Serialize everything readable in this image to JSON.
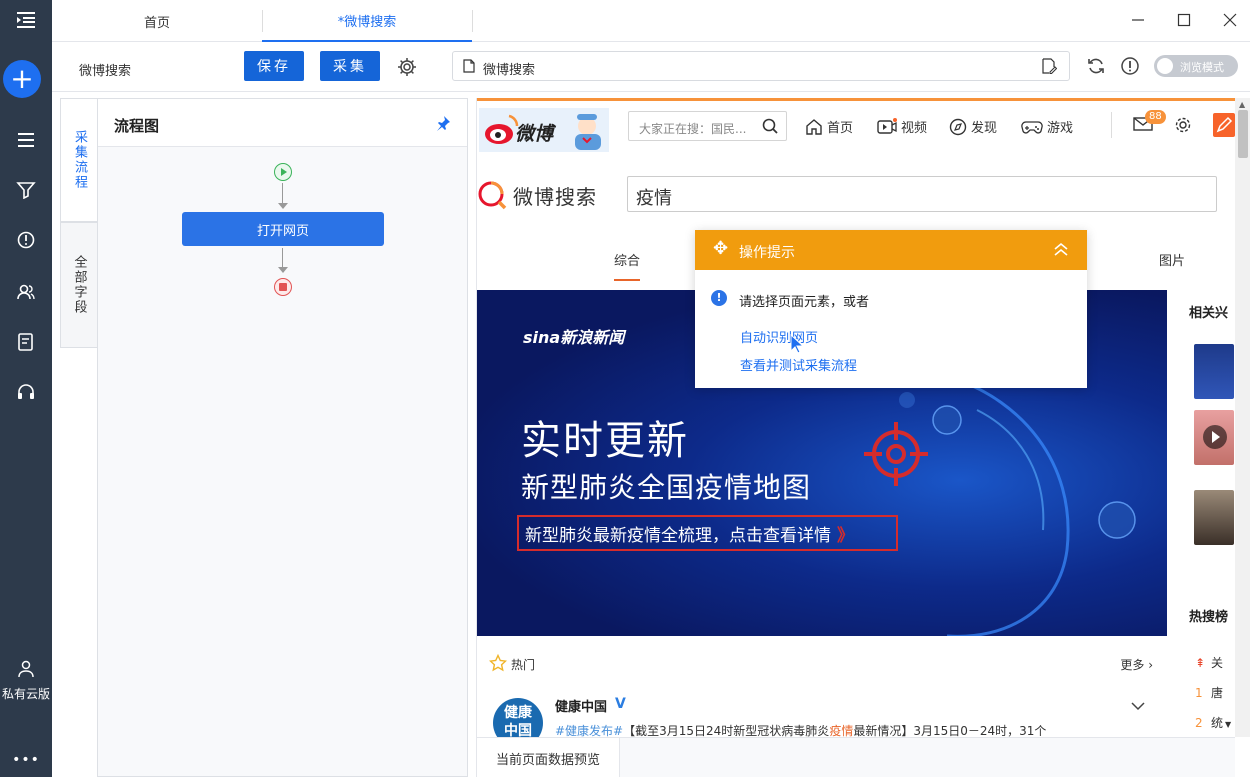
{
  "rail": {
    "icons": [
      "menu-collapse-icon",
      "plus-icon",
      "list-icon",
      "funnel-icon",
      "clock-alert-icon",
      "users-icon",
      "report-icon",
      "headset-icon",
      "user-icon"
    ],
    "account_label": "私有云版",
    "more_label": "•••",
    "accent": "#1e6ff0"
  },
  "tabs": [
    {
      "label": "首页"
    },
    {
      "label": "*微博搜索"
    }
  ],
  "toolbar": {
    "task_name": "微博搜索",
    "save_label": "保存",
    "collect_label": "采集",
    "url_text": "微博搜索",
    "browse_mode_label": "浏览模式"
  },
  "side_tabs": [
    "采集流程",
    "全部字段"
  ],
  "flow": {
    "title": "流程图",
    "node_label": "打开网页"
  },
  "weibo": {
    "logo_text": "微博",
    "search_placeholder": "大家正在搜：国民...",
    "nav": [
      "首页",
      "视频",
      "发现",
      "游戏"
    ],
    "mail_badge": "88",
    "search_logo": "微博搜索",
    "query": "疫情",
    "result_tabs": [
      "综合",
      "图片"
    ],
    "banner": {
      "brand": "sina新浪新闻",
      "headline": "实时更新",
      "subheadline": "新型肺炎全国疫情地图",
      "cta": "新型肺炎最新疫情全梳理，点击查看详情",
      "cta_chevrons": "》"
    },
    "right_heading": "相关兴",
    "hot_label": "热门",
    "more_label": "更多 ›",
    "hot_search_heading": "热搜榜",
    "hot_search_items": [
      {
        "rank": "",
        "text": "关"
      },
      {
        "rank": "1",
        "text": "唐"
      },
      {
        "rank": "2",
        "text": "统"
      }
    ],
    "post": {
      "author": "健康中国",
      "avatar_text": "健康\n中国",
      "verified_mark": "V",
      "tag": "#健康发布#",
      "text_before": "【截至3月15日24时新型冠状病毒肺炎",
      "highlight": "疫情",
      "text_after": "最新情况】3月15日0－24时，31个"
    }
  },
  "hint": {
    "title": "操作提示",
    "question": "请选择页面元素，或者",
    "link1": "自动识别网页",
    "link2": "查看并测试采集流程"
  },
  "preview_tab": "当前页面数据预览"
}
